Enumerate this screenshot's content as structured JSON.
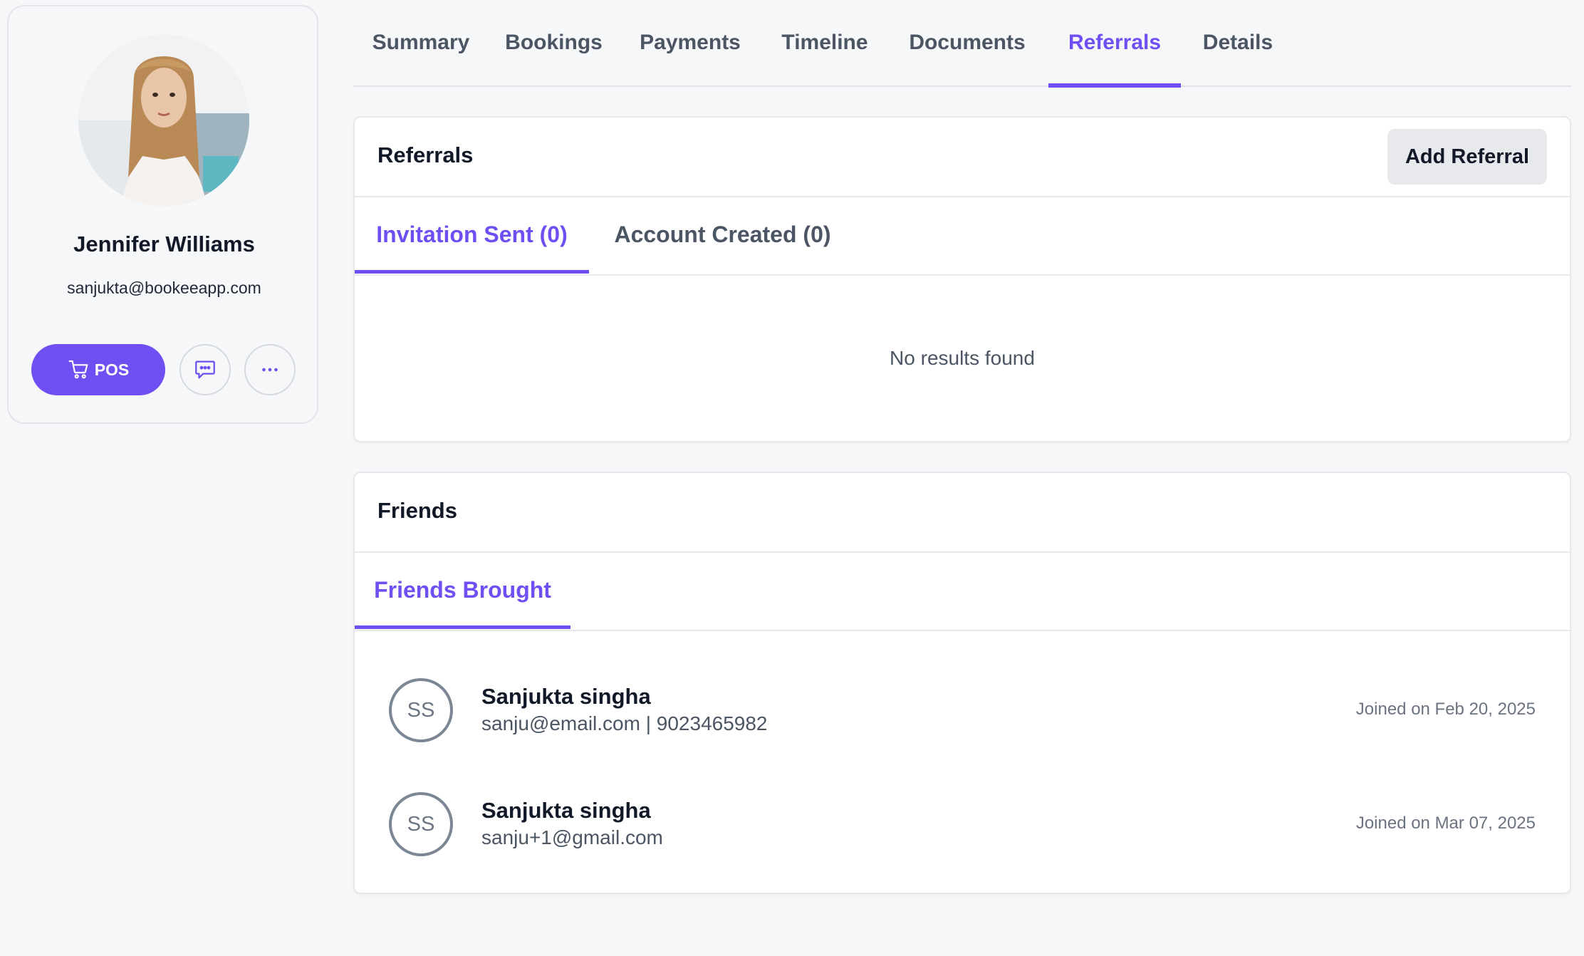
{
  "profile": {
    "name": "Jennifer Williams",
    "email": "sanjukta@bookeeapp.com",
    "pos_label": "POS"
  },
  "tabs": [
    {
      "label": "Summary",
      "active": false
    },
    {
      "label": "Bookings",
      "active": false
    },
    {
      "label": "Payments",
      "active": false
    },
    {
      "label": "Timeline",
      "active": false
    },
    {
      "label": "Documents",
      "active": false
    },
    {
      "label": "Referrals",
      "active": true
    },
    {
      "label": "Details",
      "active": false
    }
  ],
  "referrals": {
    "title": "Referrals",
    "add_button": "Add Referral",
    "tabs": [
      {
        "label": "Invitation Sent (0)",
        "active": true
      },
      {
        "label": "Account Created (0)",
        "active": false
      }
    ],
    "empty_text": "No results found"
  },
  "friends": {
    "title": "Friends",
    "tabs": [
      {
        "label": "Friends Brought",
        "active": true
      }
    ],
    "items": [
      {
        "initials": "SS",
        "name": "Sanjukta singha",
        "contact": "sanju@email.com | 9023465982",
        "joined": "Joined on Feb 20, 2025"
      },
      {
        "initials": "SS",
        "name": "Sanjukta singha",
        "contact": "sanju+1@gmail.com",
        "joined": "Joined on Mar 07, 2025"
      }
    ]
  },
  "colors": {
    "accent": "#6f4ef2",
    "background": "#f6f7f9",
    "muted_text": "#4b5563",
    "avatar_ring": "#7b8794"
  },
  "icons": {
    "pos": "cart-icon",
    "chat": "chat-bubble-icon",
    "more": "ellipsis-icon"
  }
}
